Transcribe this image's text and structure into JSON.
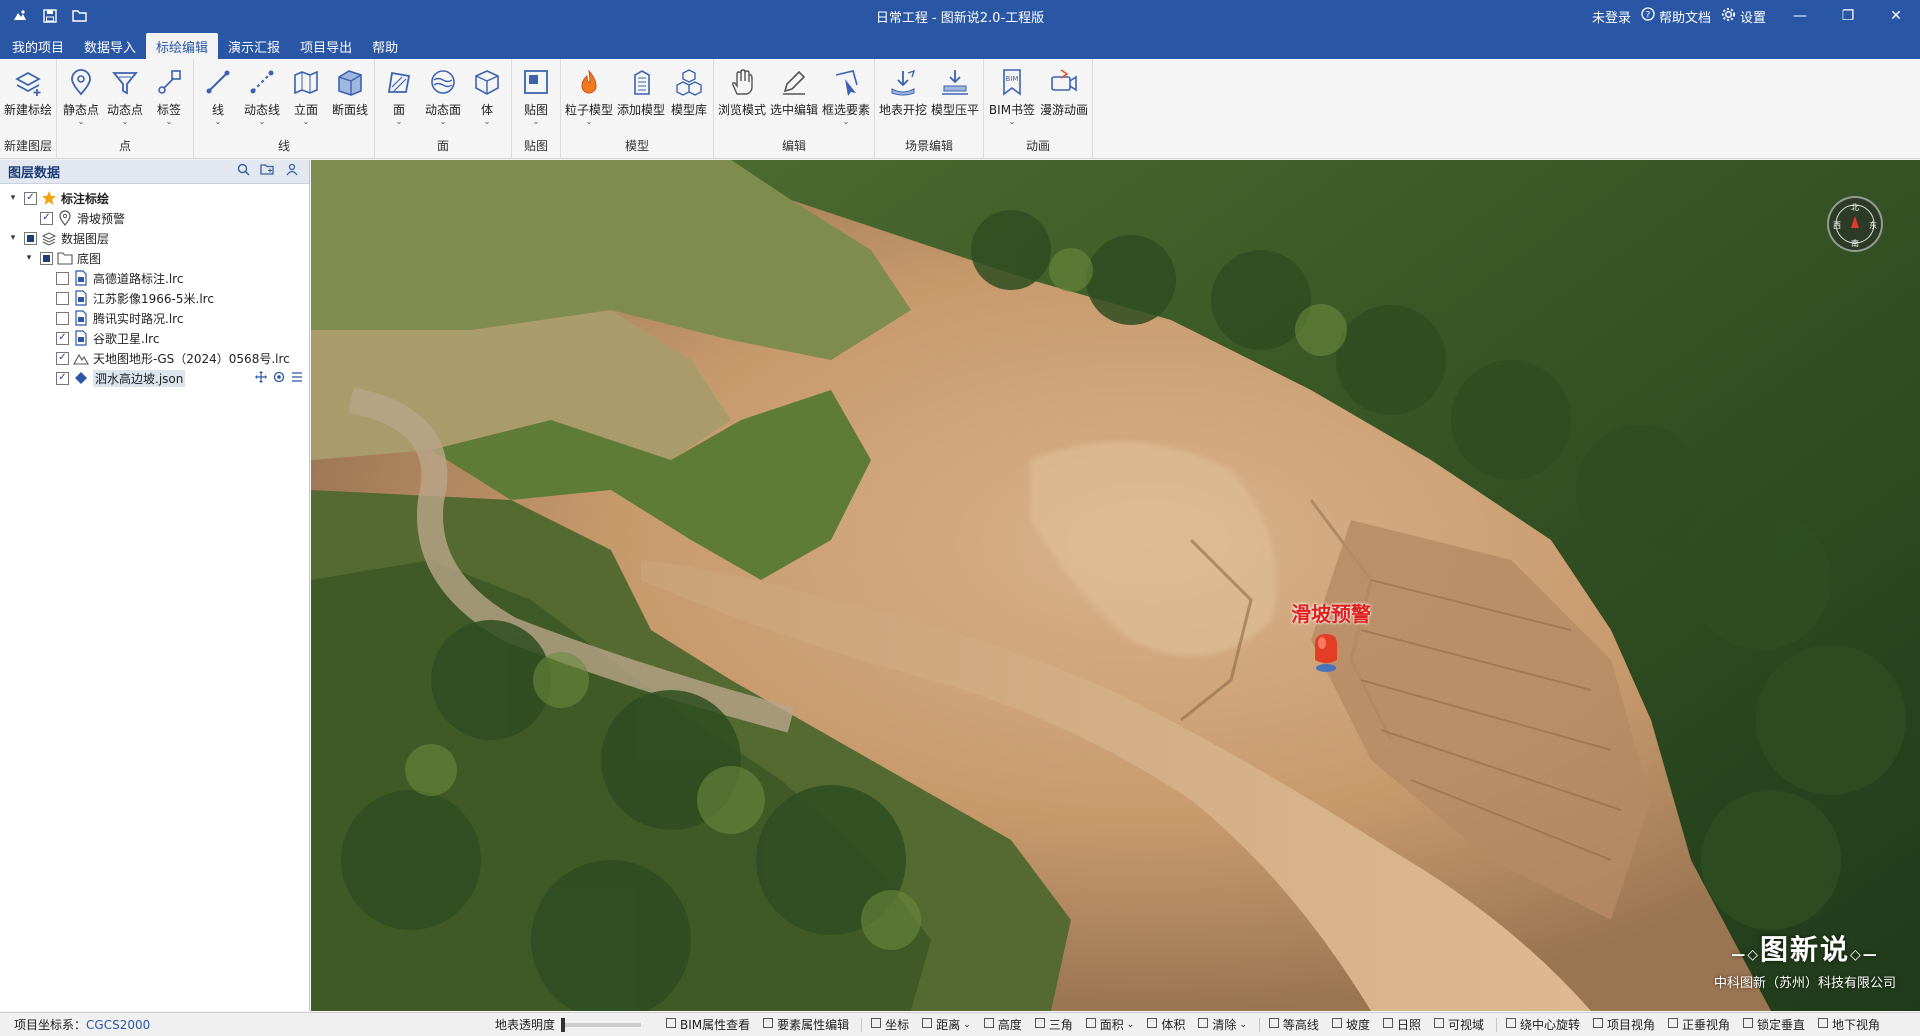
{
  "titlebar": {
    "title": "日常工程 - 图新说2.0-工程版",
    "quick_icons": [
      "app-logo-icon",
      "save-icon",
      "folder-open-icon"
    ],
    "login": "未登录",
    "help_doc": "帮助文档",
    "settings": "设置",
    "min_glyph": "—",
    "max_glyph": "❐",
    "close_glyph": "✕"
  },
  "menu": {
    "tabs": [
      {
        "label": "我的项目"
      },
      {
        "label": "数据导入"
      },
      {
        "label": "标绘编辑"
      },
      {
        "label": "演示汇报"
      },
      {
        "label": "项目导出"
      },
      {
        "label": "帮助"
      }
    ],
    "active": "标绘编辑"
  },
  "ribbon": {
    "groups": [
      {
        "label": "新建图层",
        "buttons": [
          {
            "label": "新建标绘",
            "icon": "layers-plus-icon",
            "dropdown": false
          }
        ]
      },
      {
        "label": "点",
        "buttons": [
          {
            "label": "静态点",
            "icon": "location-pin-icon",
            "dropdown": true
          },
          {
            "label": "动态点",
            "icon": "funnel-point-icon",
            "dropdown": true
          },
          {
            "label": "标签",
            "icon": "label-pin-icon",
            "dropdown": true
          }
        ]
      },
      {
        "label": "线",
        "buttons": [
          {
            "label": "线",
            "icon": "line-icon",
            "dropdown": true
          },
          {
            "label": "动态线",
            "icon": "dashed-line-icon",
            "dropdown": true
          },
          {
            "label": "立面",
            "icon": "facade-icon",
            "dropdown": true
          },
          {
            "label": "断面线",
            "icon": "section-line-icon",
            "dropdown": false
          }
        ]
      },
      {
        "label": "面",
        "buttons": [
          {
            "label": "面",
            "icon": "polygon-icon",
            "dropdown": true
          },
          {
            "label": "动态面",
            "icon": "wave-polygon-icon",
            "dropdown": true
          },
          {
            "label": "体",
            "icon": "cube-icon",
            "dropdown": true
          }
        ]
      },
      {
        "label": "贴图",
        "buttons": [
          {
            "label": "贴图",
            "icon": "texture-icon",
            "dropdown": true
          }
        ]
      },
      {
        "label": "模型",
        "buttons": [
          {
            "label": "粒子模型",
            "icon": "fire-particle-icon",
            "dropdown": true
          },
          {
            "label": "添加模型",
            "icon": "building-model-icon",
            "dropdown": false
          },
          {
            "label": "模型库",
            "icon": "model-library-icon",
            "dropdown": false
          }
        ]
      },
      {
        "label": "编辑",
        "buttons": [
          {
            "label": "浏览模式",
            "icon": "hand-icon",
            "dropdown": false
          },
          {
            "label": "选中编辑",
            "icon": "pencil-icon",
            "dropdown": false
          },
          {
            "label": "框选要素",
            "icon": "box-select-icon",
            "dropdown": true
          }
        ]
      },
      {
        "label": "场景编辑",
        "buttons": [
          {
            "label": "地表开挖",
            "icon": "excavation-icon",
            "dropdown": false
          },
          {
            "label": "模型压平",
            "icon": "flatten-icon",
            "dropdown": false
          }
        ]
      },
      {
        "label": "动画",
        "buttons": [
          {
            "label": "BIM书签",
            "icon": "bim-bookmark-icon",
            "dropdown": true
          },
          {
            "label": "漫游动画",
            "icon": "fly-animation-icon",
            "dropdown": false
          }
        ]
      }
    ]
  },
  "layer_panel": {
    "title": "图层数据",
    "tree": [
      {
        "level": 0,
        "toggle": "▾",
        "check": "checked",
        "icon": "star-icon",
        "label": "标注标绘",
        "bold": true
      },
      {
        "level": 1,
        "toggle": "",
        "check": "checked",
        "icon": "pin-outline-icon",
        "label": "滑坡预警"
      },
      {
        "level": 0,
        "toggle": "▾",
        "check": "partial",
        "icon": "layers-stack-icon",
        "label": "数据图层"
      },
      {
        "level": 1,
        "toggle": "▾",
        "check": "partial",
        "icon": "folder-icon",
        "label": "底图"
      },
      {
        "level": 2,
        "toggle": "",
        "check": "unchecked",
        "icon": "file-doc-icon",
        "label": "高德道路标注.lrc"
      },
      {
        "level": 2,
        "toggle": "",
        "check": "unchecked",
        "icon": "file-doc-icon",
        "label": "江苏影像1966-5米.lrc"
      },
      {
        "level": 2,
        "toggle": "",
        "check": "unchecked",
        "icon": "file-doc-icon",
        "label": "腾讯实时路况.lrc"
      },
      {
        "level": 2,
        "toggle": "",
        "check": "checked",
        "icon": "file-doc-icon",
        "label": "谷歌卫星.lrc"
      },
      {
        "level": 2,
        "toggle": "",
        "check": "checked",
        "icon": "terrain-icon",
        "label": "天地图地形-GS（2024）0568号.lrc"
      },
      {
        "level": 2,
        "toggle": "",
        "check": "checked",
        "icon": "diamond-icon",
        "label": "泗水高边坡.json",
        "selected": true
      }
    ]
  },
  "map": {
    "marker_label": "滑坡预警",
    "compass_letters": [
      "北",
      "东",
      "南",
      "西"
    ],
    "brand_title": "图新说",
    "brand_sub": "中科图新（苏州）科技有限公司"
  },
  "statusbar": {
    "coord_label": "项目坐标系：",
    "coord_value": "CGCS2000",
    "transparency_label": "地表透明度",
    "tools": [
      {
        "label": "BIM属性查看",
        "icon": "bim-info-icon"
      },
      {
        "label": "要素属性编辑",
        "icon": "edit-attr-icon"
      },
      {
        "label": "坐标",
        "icon": "coordinate-icon",
        "sep_before": true
      },
      {
        "label": "距离",
        "icon": "distance-icon",
        "dropdown": true
      },
      {
        "label": "高度",
        "icon": "height-icon"
      },
      {
        "label": "三角",
        "icon": "triangle-icon"
      },
      {
        "label": "面积",
        "icon": "area-icon",
        "dropdown": true
      },
      {
        "label": "体积",
        "icon": "volume-icon"
      },
      {
        "label": "清除",
        "icon": "trash-icon",
        "dropdown": true
      },
      {
        "label": "等高线",
        "icon": "contour-icon",
        "sep_before": true
      },
      {
        "label": "坡度",
        "icon": "slope-icon"
      },
      {
        "label": "日照",
        "icon": "sunlight-icon"
      },
      {
        "label": "可视域",
        "icon": "viewshed-icon"
      },
      {
        "label": "绕中心旋转",
        "icon": "rotate-center-icon",
        "sep_before": true
      },
      {
        "label": "项目视角",
        "icon": "project-view-icon"
      },
      {
        "label": "正垂视角",
        "icon": "vertical-view-icon"
      },
      {
        "label": "锁定垂直",
        "icon": "lock-vertical-icon"
      },
      {
        "label": "地下视角",
        "icon": "underground-view-icon"
      }
    ]
  }
}
